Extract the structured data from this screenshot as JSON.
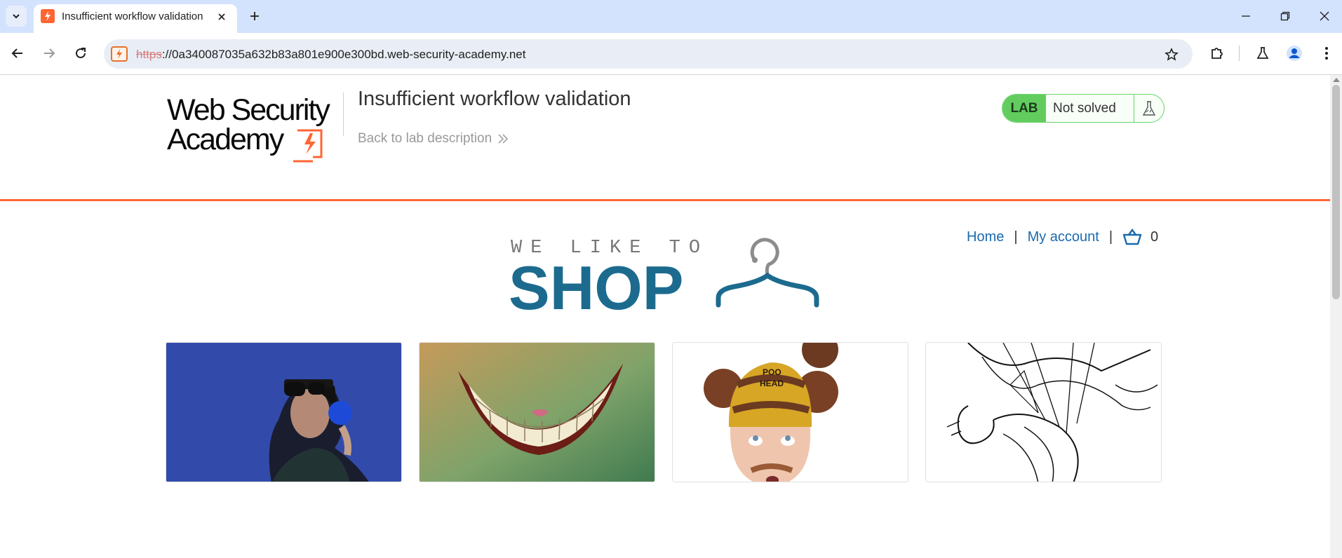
{
  "browser": {
    "tab_title": "Insufficient workflow validation",
    "url_scheme": "https",
    "url_rest": "://0a340087035a632b83a801e900e300bd.web-security-academy.net"
  },
  "header": {
    "logo_line1": "Web Security",
    "logo_line2": "Academy",
    "lab_title": "Insufficient workflow validation",
    "back_link": "Back to lab description",
    "status_label": "LAB",
    "status_text": "Not solved"
  },
  "nav": {
    "home": "Home",
    "my_account": "My account",
    "separator": "|",
    "cart_count": "0"
  },
  "banner": {
    "tagline": "WE LIKE TO",
    "headline": "SHOP"
  },
  "colors": {
    "accent_orange": "#ff6633",
    "link_blue": "#1a6bb0",
    "shop_blue": "#1c6b8f",
    "lab_green": "#63cc5f"
  },
  "products": [
    {
      "name": "product-image-headphones"
    },
    {
      "name": "product-image-grin"
    },
    {
      "name": "product-image-poo-head"
    },
    {
      "name": "product-image-sketch"
    }
  ]
}
